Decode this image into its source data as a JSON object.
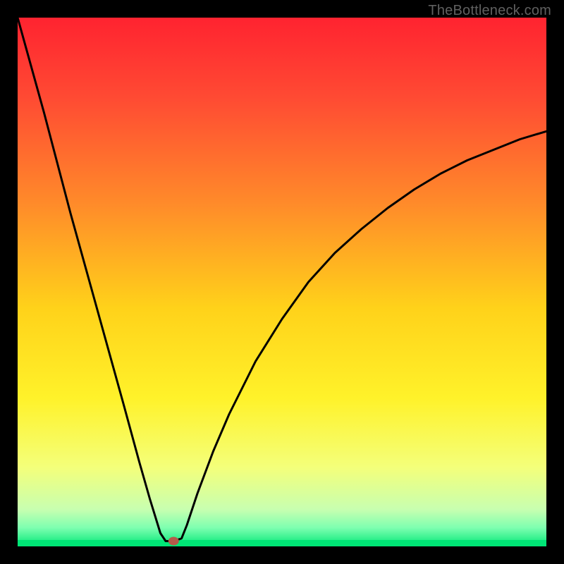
{
  "watermark": "TheBottleneck.com",
  "chart_data": {
    "type": "line",
    "title": "",
    "xlabel": "",
    "ylabel": "",
    "xlim": [
      0,
      100
    ],
    "ylim": [
      0,
      100
    ],
    "grid": false,
    "background": "rainbow-vertical (red top -> green bottom)",
    "series": [
      {
        "name": "bottleneck-curve",
        "x": [
          0,
          5,
          10,
          15,
          20,
          23,
          25,
          27,
          28,
          29.5,
          31,
          32,
          34,
          37,
          40,
          45,
          50,
          55,
          60,
          65,
          70,
          75,
          80,
          85,
          90,
          95,
          100
        ],
        "y": [
          100,
          82,
          63,
          45,
          27,
          16,
          9,
          2.5,
          1,
          1,
          1.5,
          4,
          10,
          18,
          25,
          35,
          43,
          50,
          55.5,
          60,
          64,
          67.5,
          70.5,
          73,
          75,
          77,
          78.5
        ]
      }
    ],
    "marker": {
      "name": "optimal-point",
      "x": 29.5,
      "y": 1,
      "color": "#b55a4a"
    },
    "plateau_bottom_color": "#00e676",
    "gradient_stops": [
      {
        "offset": 0.0,
        "color": "#ff2330"
      },
      {
        "offset": 0.15,
        "color": "#ff4a33"
      },
      {
        "offset": 0.35,
        "color": "#ff8a2a"
      },
      {
        "offset": 0.55,
        "color": "#ffd21a"
      },
      {
        "offset": 0.72,
        "color": "#fff22a"
      },
      {
        "offset": 0.85,
        "color": "#f4ff7a"
      },
      {
        "offset": 0.93,
        "color": "#c8ffb0"
      },
      {
        "offset": 0.965,
        "color": "#7dffb0"
      },
      {
        "offset": 1.0,
        "color": "#00e676"
      }
    ]
  }
}
